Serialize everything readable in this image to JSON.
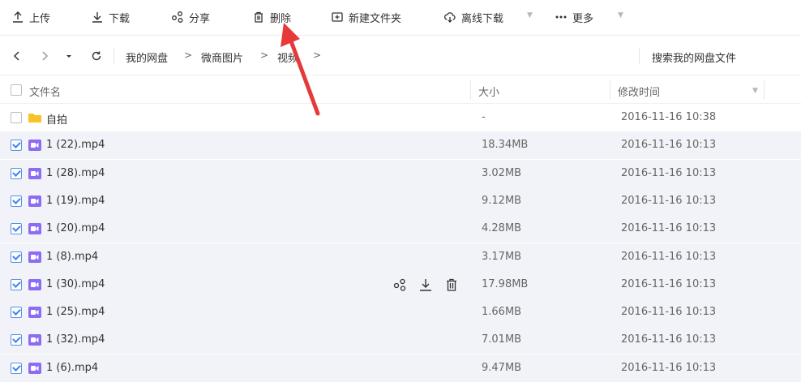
{
  "toolbar": {
    "upload": "上传",
    "download": "下载",
    "share": "分享",
    "delete": "删除",
    "new_folder": "新建文件夹",
    "offline_download": "离线下载",
    "more": "更多"
  },
  "breadcrumb": {
    "items": [
      "我的网盘",
      "微商图片",
      "视频"
    ],
    "separator": ">",
    "search_label": "搜索我的网盘文件"
  },
  "table": {
    "headers": {
      "name": "文件名",
      "size": "大小",
      "modified": "修改时间"
    },
    "rows": [
      {
        "name": "自拍",
        "type": "folder",
        "size": "-",
        "date": "2016-11-16 10:38",
        "checked": false
      },
      {
        "name": "1 (22).mp4",
        "type": "video",
        "size": "18.34MB",
        "date": "2016-11-16 10:13",
        "checked": true
      },
      {
        "name": "1 (28).mp4",
        "type": "video",
        "size": "3.02MB",
        "date": "2016-11-16 10:13",
        "checked": true
      },
      {
        "name": "1 (19).mp4",
        "type": "video",
        "size": "9.12MB",
        "date": "2016-11-16 10:13",
        "checked": true
      },
      {
        "name": "1 (20).mp4",
        "type": "video",
        "size": "4.28MB",
        "date": "2016-11-16 10:13",
        "checked": true
      },
      {
        "name": "1 (8).mp4",
        "type": "video",
        "size": "3.17MB",
        "date": "2016-11-16 10:13",
        "checked": true
      },
      {
        "name": "1 (30).mp4",
        "type": "video",
        "size": "17.98MB",
        "date": "2016-11-16 10:13",
        "checked": true
      },
      {
        "name": "1 (25).mp4",
        "type": "video",
        "size": "1.66MB",
        "date": "2016-11-16 10:13",
        "checked": true
      },
      {
        "name": "1 (32).mp4",
        "type": "video",
        "size": "7.01MB",
        "date": "2016-11-16 10:13",
        "checked": true
      },
      {
        "name": "1 (6).mp4",
        "type": "video",
        "size": "9.47MB",
        "date": "2016-11-16 10:13",
        "checked": true
      }
    ]
  },
  "colors": {
    "video_icon": "#8c6cf0",
    "folder_icon": "#f8c326",
    "checkbox_accent": "#3b82f0",
    "selected_row": "#f1f3f8",
    "annotation_arrow": "#e63a3a"
  }
}
